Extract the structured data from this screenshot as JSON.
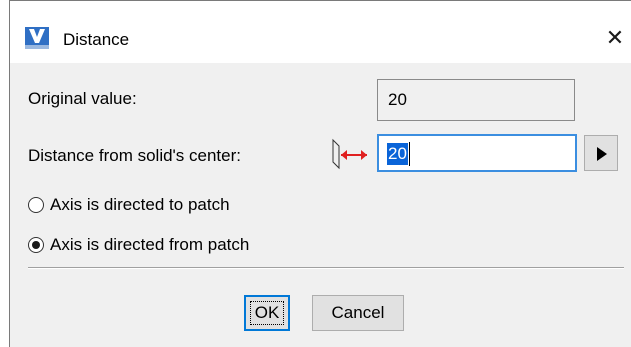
{
  "window": {
    "title": "Distance",
    "close_glyph": "✕",
    "app_icon": "app-logo-icon"
  },
  "fields": {
    "original_label": "Original value:",
    "original_value": "20",
    "distance_label": "Distance from solid's center:",
    "distance_value": "20",
    "distance_icon": "distance-arrows-icon",
    "arrow_button_icon": "play-right-arrow-icon"
  },
  "options": [
    {
      "label": "Axis is directed to patch",
      "checked": false
    },
    {
      "label": "Axis is directed from patch",
      "checked": true
    }
  ],
  "buttons": {
    "ok": "OK",
    "cancel": "Cancel"
  },
  "colors": {
    "accent": "#0078d7",
    "selection": "#0a64d8",
    "dialog_bg": "#f0f0f0"
  }
}
